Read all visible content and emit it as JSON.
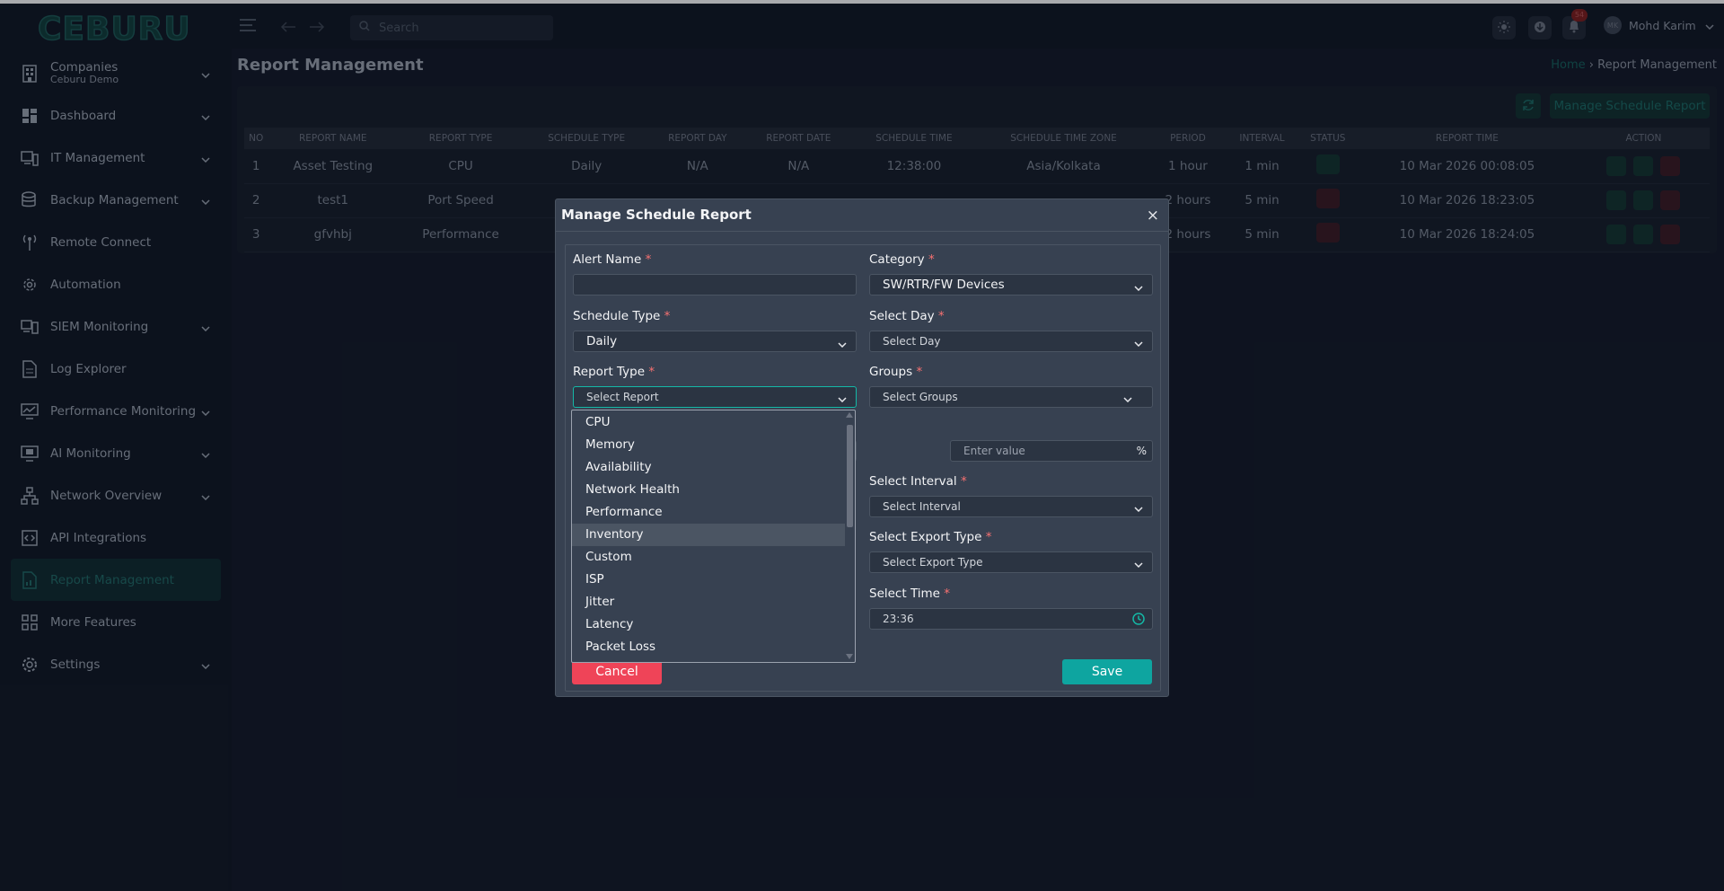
{
  "brand": "CEBURU",
  "search": {
    "placeholder": "Search"
  },
  "notifications": {
    "count": "54"
  },
  "user": {
    "initials": "MK",
    "name": "Mohd Karim"
  },
  "sidebar": {
    "items": [
      {
        "label": "Companies",
        "sublabel": "Ceburu Demo"
      },
      {
        "label": "Dashboard"
      },
      {
        "label": "IT Management"
      },
      {
        "label": "Backup Management"
      },
      {
        "label": "Remote Connect"
      },
      {
        "label": "Automation"
      },
      {
        "label": "SIEM Monitoring"
      },
      {
        "label": "Log Explorer"
      },
      {
        "label": "Performance Monitoring"
      },
      {
        "label": "AI Monitoring"
      },
      {
        "label": "Network Overview"
      },
      {
        "label": "API Integrations"
      },
      {
        "label": "Report Management"
      },
      {
        "label": "More Features"
      },
      {
        "label": "Settings"
      }
    ]
  },
  "page": {
    "title": "Report Management",
    "breadcrumb_home": "Home",
    "breadcrumb_sep": "›",
    "breadcrumb_current": "Report Management",
    "manage_button": "Manage Schedule Report"
  },
  "table": {
    "headers": [
      "NO",
      "REPORT NAME",
      "REPORT TYPE",
      "SCHEDULE TYPE",
      "REPORT DAY",
      "REPORT DATE",
      "SCHEDULE TIME",
      "SCHEDULE TIME ZONE",
      "PERIOD",
      "INTERVAL",
      "STATUS",
      "REPORT TIME",
      "ACTION"
    ],
    "rows": [
      [
        "1",
        "Asset Testing",
        "CPU",
        "Daily",
        "N/A",
        "N/A",
        "12:38:00",
        "Asia/Kolkata",
        "1 hour",
        "1 min",
        "",
        "10 Mar 2026 00:08:05",
        ""
      ],
      [
        "2",
        "test1",
        "Port Speed",
        "",
        "",
        "",
        "",
        "",
        "2 hours",
        "5 min",
        "",
        "10 Mar 2026 18:23:05",
        ""
      ],
      [
        "3",
        "gfvhbj",
        "Performance",
        "",
        "",
        "",
        "",
        "",
        "2 hours",
        "5 min",
        "",
        "10 Mar 2026 18:24:05",
        ""
      ]
    ]
  },
  "modal": {
    "title": "Manage Schedule Report",
    "close": "×",
    "required_mark": "*",
    "alert_name": {
      "label": "Alert Name",
      "value": ""
    },
    "category": {
      "label": "Category",
      "value": "SW/RTR/FW Devices"
    },
    "schedule_type": {
      "label": "Schedule Type",
      "value": "Daily"
    },
    "select_day": {
      "label": "Select Day",
      "placeholder": "Select Day"
    },
    "report_type": {
      "label": "Report Type",
      "placeholder": "Select Report"
    },
    "groups": {
      "label": "Groups",
      "placeholder": "Select Groups"
    },
    "threshold": {
      "placeholder": "Enter value",
      "unit": "%"
    },
    "select_interval": {
      "label": "Select Interval",
      "placeholder": "Select Interval"
    },
    "export_type": {
      "label": "Select Export Type",
      "placeholder": "Select Export Type"
    },
    "select_time": {
      "label": "Select Time",
      "value": "23:36"
    },
    "cancel": "Cancel",
    "save": "Save"
  },
  "report_type_options": [
    "CPU",
    "Memory",
    "Availability",
    "Network Health",
    "Performance",
    "Inventory",
    "Custom",
    "ISP",
    "Jitter",
    "Latency",
    "Packet Loss"
  ],
  "highlighted_option": "Inventory",
  "colors": {
    "accent": "#0ea5a0",
    "danger": "#ef4458",
    "modal_bg": "#374151",
    "page_bg": "#111827"
  }
}
